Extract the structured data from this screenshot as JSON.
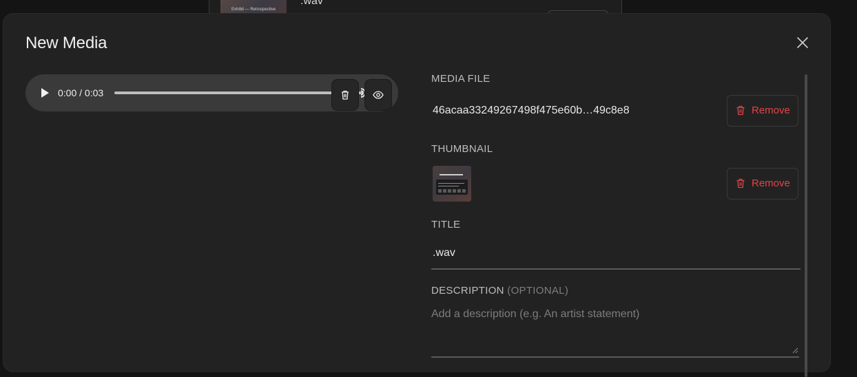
{
  "background": {
    "item_title": ".wav",
    "thumb_caption": "Exhibit — Retrospective"
  },
  "modal": {
    "title": "New Media"
  },
  "player": {
    "time": "0:00 / 0:03"
  },
  "media_file": {
    "label": "MEDIA FILE",
    "file_name": "46acaa33249267498f475e60b…49c8e8",
    "remove_label": "Remove"
  },
  "thumbnail": {
    "label": "THUMBNAIL",
    "remove_label": "Remove"
  },
  "title_field": {
    "label": "TITLE",
    "value": ".wav"
  },
  "description_field": {
    "label": "DESCRIPTION",
    "optional": "(OPTIONAL)",
    "placeholder": "Add a description (e.g. An artist statement)"
  },
  "colors": {
    "modal_bg": "#222222",
    "danger": "#e0454a",
    "player_bg": "#3a3a3a"
  }
}
